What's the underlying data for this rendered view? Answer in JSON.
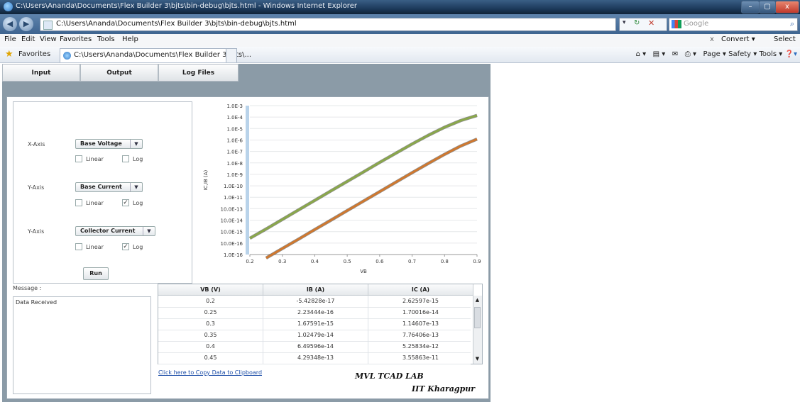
{
  "window": {
    "title": "C:\\Users\\Ananda\\Documents\\Flex Builder 3\\bjts\\bin-debug\\bjts.html - Windows Internet Explorer",
    "minimize": "–",
    "maximize": "▢",
    "close": "x"
  },
  "addressbar": {
    "url": "C:\\Users\\Ananda\\Documents\\Flex Builder 3\\bjts\\bin-debug\\bjts.html",
    "search_placeholder": "Google"
  },
  "menu": {
    "items": [
      "File",
      "Edit",
      "View",
      "Favorites",
      "Tools",
      "Help"
    ],
    "close_x": "x",
    "convert": "Convert",
    "select": "Select"
  },
  "favbar": {
    "favorites_label": "Favorites",
    "tab_title": "C:\\Users\\Ananda\\Documents\\Flex Builder 3\\bjts\\...",
    "commands": "Page ▾  Safety ▾  Tools ▾"
  },
  "app": {
    "tabs": [
      "Input",
      "Output",
      "Log Files"
    ],
    "controls": {
      "x_axis_label": "X-Axis",
      "x_axis_value": "Base Voltage",
      "y_axis1_label": "Y-Axis",
      "y_axis1_value": "Base Current",
      "y_axis2_label": "Y-Axis",
      "y_axis2_value": "Collector Current",
      "linear_label": "Linear",
      "log_label": "Log",
      "run_label": "Run"
    },
    "message_label": "Message :",
    "message_text": "Data Received",
    "copy_link": "Click here to Copy Data to Clipboard",
    "brand_line1": "MVL TCAD LAB",
    "brand_line2": "IIT Kharagpur",
    "table": {
      "headers": [
        "VB (V)",
        "IB (A)",
        "IC (A)"
      ],
      "rows": [
        [
          "0.2",
          "-5.42828e-17",
          "2.62597e-15"
        ],
        [
          "0.25",
          "2.23444e-16",
          "1.70016e-14"
        ],
        [
          "0.3",
          "1.67591e-15",
          "1.14607e-13"
        ],
        [
          "0.35",
          "1.02479e-14",
          "7.76406e-13"
        ],
        [
          "0.4",
          "6.49596e-14",
          "5.25834e-12"
        ],
        [
          "0.45",
          "4.29348e-13",
          "3.55863e-11"
        ]
      ]
    }
  },
  "chart_data": {
    "type": "line",
    "title": "",
    "xlabel": "VB",
    "ylabel": "IC,IB (A)",
    "xlim": [
      0.2,
      0.9
    ],
    "x_ticks": [
      "0.2",
      "0.3",
      "0.4",
      "0.5",
      "0.6",
      "0.7",
      "0.8",
      "0.9"
    ],
    "y_ticks": [
      "1.0E-3",
      "1.0E-4",
      "1.0E-5",
      "1.0E-6",
      "1.0E-7",
      "1.0E-8",
      "1.0E-9",
      "1.0E-10",
      "1.0E-11",
      "10.0E-13",
      "10.0E-14",
      "10.0E-15",
      "10.0E-16",
      "1.0E-16"
    ],
    "log_scale": true,
    "grid": true,
    "series": [
      {
        "color": "#8aa84a",
        "x": [
          0.2,
          0.25,
          0.3,
          0.35,
          0.4,
          0.45,
          0.5,
          0.55,
          0.6,
          0.65,
          0.7,
          0.75,
          0.8,
          0.85,
          0.9
        ],
        "y": [
          2.6e-15,
          1.7e-14,
          1.15e-13,
          7.8e-13,
          5.3e-12,
          3.6e-11,
          2.4e-10,
          1.6e-09,
          1.1e-08,
          7e-08,
          4.5e-07,
          2.6e-06,
          1.3e-05,
          5e-05,
          0.00014
        ]
      },
      {
        "color": "#d0782e",
        "x": [
          0.25,
          0.3,
          0.35,
          0.4,
          0.45,
          0.5,
          0.55,
          0.6,
          0.65,
          0.7,
          0.75,
          0.8,
          0.85,
          0.9
        ],
        "y": [
          5e-17,
          3.3e-16,
          2.2e-15,
          1.5e-14,
          1e-13,
          6.8e-13,
          4.6e-12,
          3.1e-11,
          2.1e-10,
          1.4e-09,
          9e-09,
          5.6e-08,
          3e-07,
          1.2e-06
        ]
      }
    ]
  }
}
